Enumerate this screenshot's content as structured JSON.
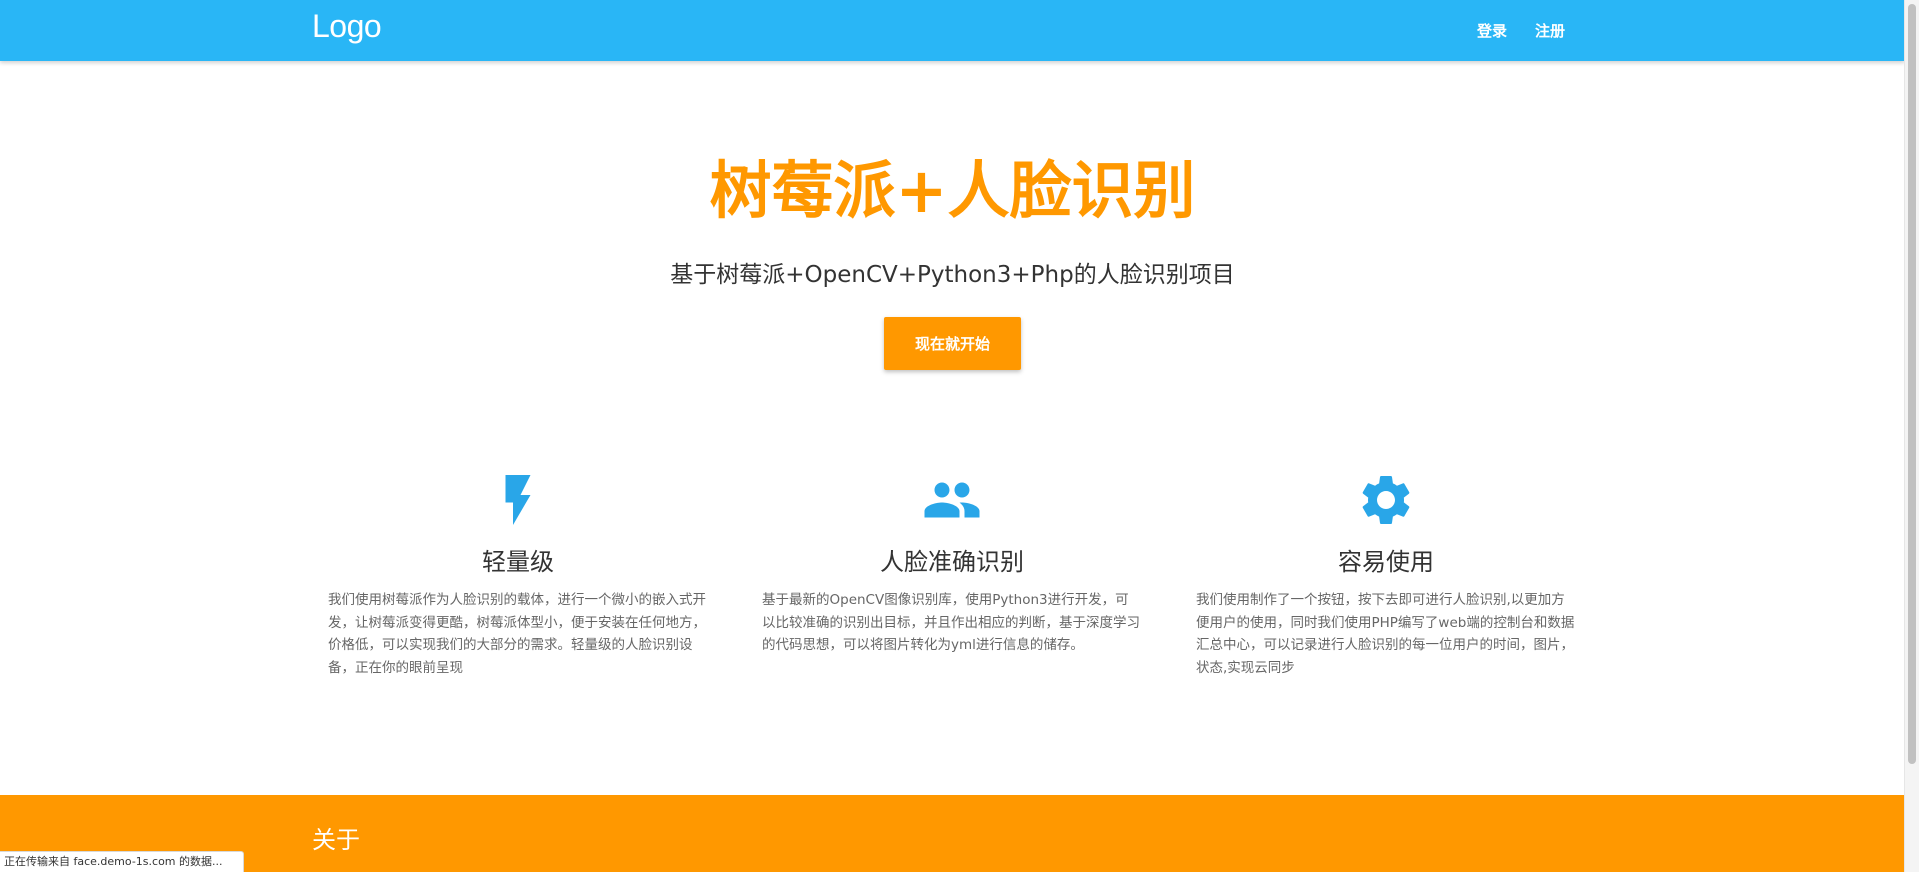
{
  "navbar": {
    "logo": "Logo",
    "links": [
      "登录",
      "注册"
    ],
    "color": "#29b6f6"
  },
  "hero": {
    "title": "树莓派+人脸识别",
    "subtitle": "基于树莓派+OpenCV+Python3+Php的人脸识别项目",
    "cta_label": "现在就开始",
    "accent_color": "#ff9800"
  },
  "features": [
    {
      "icon": "flash-icon",
      "title": "轻量级",
      "text": "我们使用树莓派作为人脸识别的载体，进行一个微小的嵌入式开发，让树莓派变得更酷，树莓派体型小，便于安装在任何地方，价格低，可以实现我们的大部分的需求。轻量级的人脸识别设备，正在你的眼前呈现"
    },
    {
      "icon": "people-icon",
      "title": "人脸准确识别",
      "text": "基于最新的OpenCV图像识别库，使用Python3进行开发，可以比较准确的识别出目标，并且作出相应的判断，基于深度学习的代码思想，可以将图片转化为yml进行信息的储存。"
    },
    {
      "icon": "gear-icon",
      "title": "容易使用",
      "text": "我们使用制作了一个按钮，按下去即可进行人脸识别,以更加方便用户的使用，同时我们使用PHP编写了web端的控制台和数据汇总中心，可以记录进行人脸识别的每一位用户的时间，图片，状态,实现云同步"
    }
  ],
  "about": {
    "title": "关于",
    "color": "#ff9800"
  },
  "status_bar": {
    "text": "正在传输来自 face.demo-1s.com 的数据..."
  }
}
